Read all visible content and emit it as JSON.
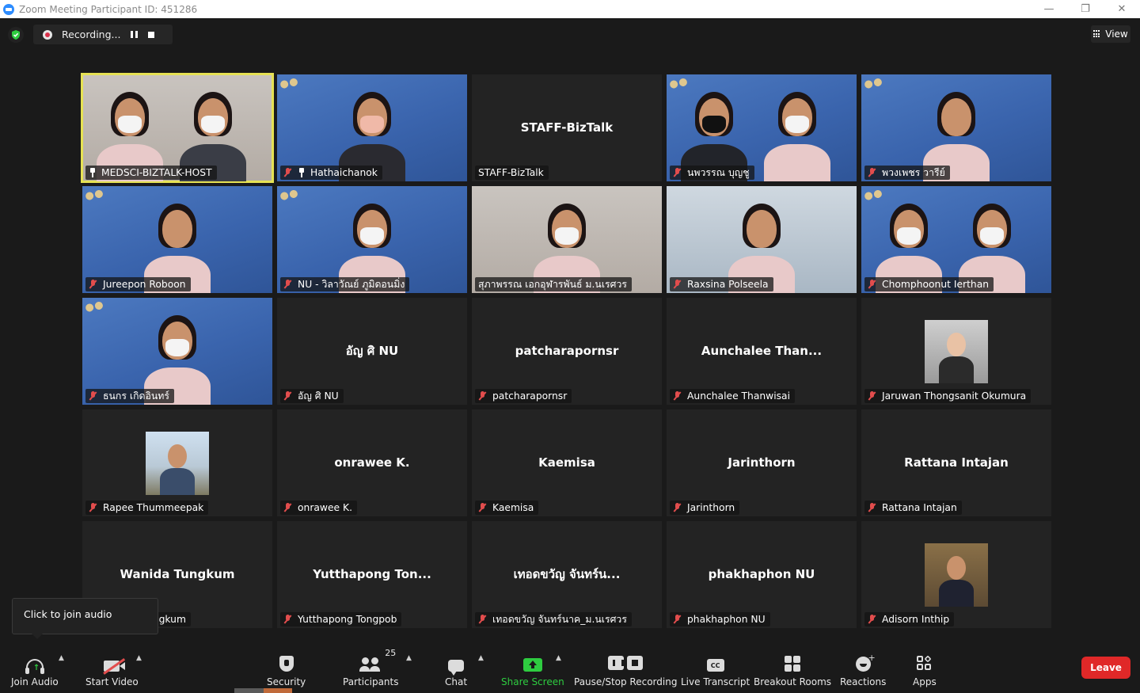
{
  "window": {
    "title": "Zoom Meeting Participant ID: 451286",
    "minimize": "—",
    "restore": "❐",
    "close": "✕"
  },
  "recording": {
    "label": "Recording..."
  },
  "view": {
    "label": "View"
  },
  "participants": [
    {
      "name": "MEDSCI-BIZTALK-HOST",
      "display": "",
      "video": true,
      "active": true,
      "muted": false,
      "pinned": true
    },
    {
      "name": "Hathaichanok",
      "display": "",
      "video": true,
      "muted": true,
      "pinned": true
    },
    {
      "name": "STAFF-BizTalk",
      "display": "STAFF-BizTalk",
      "video": false,
      "muted": false
    },
    {
      "name": "นพวรรณ บุญชู",
      "display": "",
      "video": true,
      "muted": true
    },
    {
      "name": "พวงเพชร วารีย์",
      "display": "",
      "video": true,
      "muted": true
    },
    {
      "name": "Jureepon Roboon",
      "display": "",
      "video": true,
      "muted": true
    },
    {
      "name": "NU - วิลาวัณย์ ภูมิดอนมิ่ง",
      "display": "",
      "video": true,
      "muted": true
    },
    {
      "name": "สุภาพรรณ เอกอุฬารพันธ์ ม.นเรศวร",
      "display": "",
      "video": true,
      "muted": false
    },
    {
      "name": "Raxsina Polseela",
      "display": "",
      "video": true,
      "muted": true
    },
    {
      "name": "Chomphoonut Ierthan",
      "display": "",
      "video": true,
      "muted": true
    },
    {
      "name": "ธนกร เกิดอินทร์",
      "display": "",
      "video": true,
      "muted": true
    },
    {
      "name": "อัญ ศิ NU",
      "display": "อัญ ศิ NU",
      "video": false,
      "muted": true
    },
    {
      "name": "patcharapornsr",
      "display": "patcharapornsr",
      "video": false,
      "muted": true
    },
    {
      "name": "Aunchalee Thanwisai",
      "display": "Aunchalee  Than...",
      "video": false,
      "muted": true
    },
    {
      "name": "Jaruwan Thongsanit Okumura",
      "display": "",
      "video": false,
      "photo": true,
      "muted": true
    },
    {
      "name": "Rapee Thummeepak",
      "display": "",
      "video": false,
      "photo": true,
      "muted": true
    },
    {
      "name": "onrawee K.",
      "display": "onrawee K.",
      "video": false,
      "muted": true
    },
    {
      "name": "Kaemisa",
      "display": "Kaemisa",
      "video": false,
      "muted": true
    },
    {
      "name": "Jarinthorn",
      "display": "Jarinthorn",
      "video": false,
      "muted": true
    },
    {
      "name": "Rattana Intajan",
      "display": "Rattana Intajan",
      "video": false,
      "muted": true
    },
    {
      "name": "Wanida Tungkum",
      "display": "Wanida Tungkum",
      "video": false,
      "muted": true
    },
    {
      "name": "Yutthapong Tongpob",
      "display": "Yutthapong  Ton...",
      "video": false,
      "muted": true
    },
    {
      "name": "เทอดขวัญ จันทร์นาค_ม.นเรศวร",
      "display": "เทอดขวัญ จันทร์น...",
      "video": false,
      "muted": true
    },
    {
      "name": "phakhaphon NU",
      "display": "phakhaphon NU",
      "video": false,
      "muted": true
    },
    {
      "name": "Adisorn Inthip",
      "display": "",
      "video": false,
      "photo": true,
      "muted": true
    }
  ],
  "tooltip": {
    "text": "Click to join audio"
  },
  "toolbar": {
    "join_audio": "Join Audio",
    "start_video": "Start Video",
    "security": "Security",
    "participants": "Participants",
    "participants_count": "25",
    "chat": "Chat",
    "share_screen": "Share Screen",
    "pause_stop_recording": "Pause/Stop Recording",
    "live_transcript": "Live Transcript",
    "cc_badge": "CC",
    "breakout_rooms": "Breakout Rooms",
    "reactions": "Reactions",
    "apps": "Apps",
    "leave": "Leave"
  },
  "colors": {
    "background": "#1a1a1a",
    "tile": "#232323",
    "active_speaker": "#e6e254",
    "share_green": "#2ecc40",
    "leave_red": "#e02828",
    "muted_red": "#e24d4d"
  }
}
